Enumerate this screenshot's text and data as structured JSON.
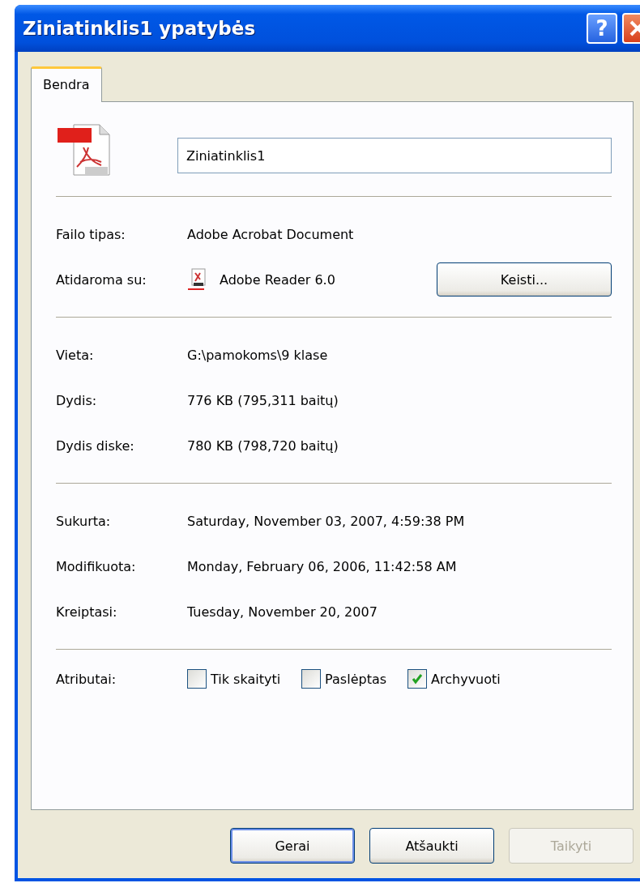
{
  "window": {
    "title": "Ziniatinklis1 ypatybės",
    "help_button": "?"
  },
  "tabs": [
    {
      "label": "Bendra",
      "selected": true
    }
  ],
  "file": {
    "name": "Ziniatinklis1"
  },
  "sections": [
    {
      "rows": [
        {
          "kind": "text",
          "label": "Failo tipas:",
          "value": "Adobe Acrobat Document"
        },
        {
          "kind": "app",
          "label": "Atidaroma su:",
          "value": "Adobe Reader 6.0",
          "button": "Keisti..."
        }
      ]
    },
    {
      "rows": [
        {
          "kind": "text",
          "label": "Vieta:",
          "value": "G:\\pamokoms\\9 klase"
        },
        {
          "kind": "text",
          "label": "Dydis:",
          "value": "776 KB (795,311 baitų)"
        },
        {
          "kind": "text",
          "label": "Dydis diske:",
          "value": "780 KB (798,720 baitų)"
        }
      ]
    },
    {
      "rows": [
        {
          "kind": "text",
          "label": "Sukurta:",
          "value": "Saturday, November 03, 2007, 4:59:38 PM"
        },
        {
          "kind": "text",
          "label": "Modifikuota:",
          "value": "Monday, February 06, 2006, 11:42:58 AM"
        },
        {
          "kind": "text",
          "label": "Kreiptasi:",
          "value": "Tuesday, November 20, 2007"
        }
      ]
    }
  ],
  "attributes": {
    "label": "Atributai:",
    "checkboxes": [
      {
        "label": "Tik skaityti",
        "checked": false
      },
      {
        "label": "Paslėptas",
        "checked": false
      },
      {
        "label": "Archyvuoti",
        "checked": true
      }
    ]
  },
  "buttons": [
    {
      "label": "Gerai",
      "default": true,
      "disabled": false
    },
    {
      "label": "Atšaukti",
      "default": false,
      "disabled": false
    },
    {
      "label": "Taikyti",
      "default": false,
      "disabled": true
    }
  ]
}
